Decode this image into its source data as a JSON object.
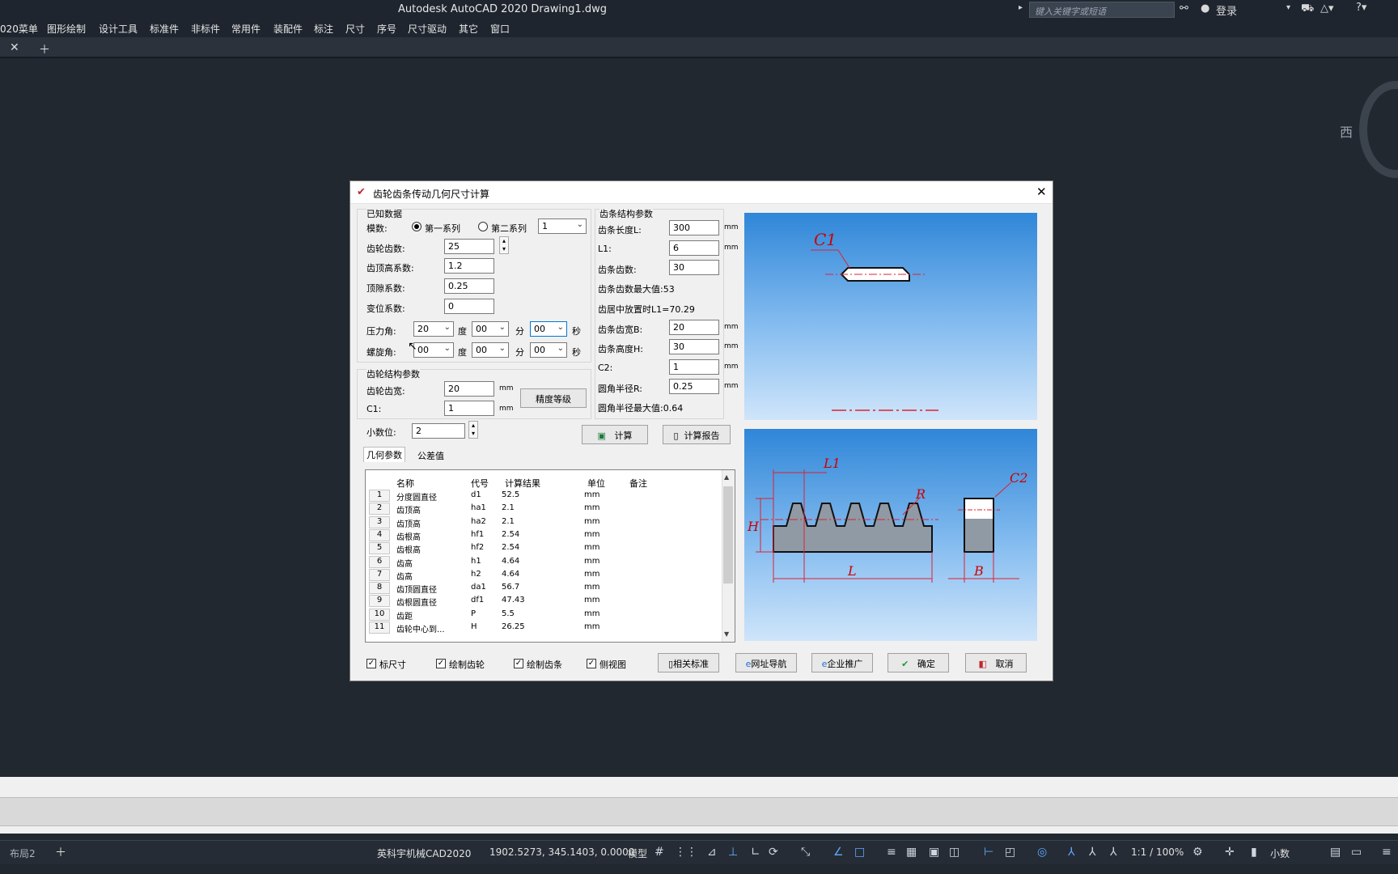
{
  "app": {
    "title": "Autodesk AutoCAD 2020    Drawing1.dwg",
    "search_placeholder": "键入关键字或短语",
    "login": "登录"
  },
  "menu": [
    "020菜单",
    "图形绘制",
    "设计工具",
    "标准件",
    "非标件",
    "常用件",
    "装配件",
    "标注",
    "尺寸",
    "序号",
    "尺寸驱动",
    "其它",
    "窗口"
  ],
  "viewcube": {
    "label": "西"
  },
  "status": {
    "layout_tab": "布局2",
    "software": "英科宇机械CAD2020",
    "coords": "1902.5273, 345.1403, 0.0000",
    "model": "模型",
    "scale": "1:1 / 100%",
    "units": "小数"
  },
  "dialog": {
    "title": "齿轮齿条传动几何尺寸计算",
    "known_group": "已知数据",
    "module_label": "模数:",
    "series1": "第一系列",
    "series2": "第二系列",
    "module_value": "1",
    "teeth_label": "齿轮齿数:",
    "teeth_value": "25",
    "addendum_label": "齿顶高系数:",
    "addendum_value": "1.2",
    "clearance_label": "顶隙系数:",
    "clearance_value": "0.25",
    "shift_label": "变位系数:",
    "shift_value": "0",
    "pressure_label": "压力角:",
    "pressure_deg": "20",
    "pressure_min": "00",
    "pressure_sec": "00",
    "helix_label": "螺旋角:",
    "helix_deg": "00",
    "helix_min": "00",
    "helix_sec": "00",
    "deg": "度",
    "min": "分",
    "sec": "秒",
    "gear_struct_group": "齿轮结构参数",
    "gear_width_label": "齿轮齿宽:",
    "gear_width_value": "20",
    "c1_label": "C1:",
    "c1_value": "1",
    "precision_button": "精度等级",
    "decimals_label": "小数位:",
    "decimals_value": "2",
    "calc_button": "计算",
    "report_button": "计算报告",
    "rack_group": "齿条结构参数",
    "rack_len_label": "齿条长度L:",
    "rack_len_value": "300",
    "l1_label": "L1:",
    "l1_value": "6",
    "rack_teeth_label": "齿条齿数:",
    "rack_teeth_value": "30",
    "rack_teeth_max": "齿条齿数最大值:53",
    "center_note": "齿居中放置时L1=70.29",
    "rack_width_label": "齿条齿宽B:",
    "rack_width_value": "20",
    "rack_height_label": "齿条高度H:",
    "rack_height_value": "30",
    "c2_label": "C2:",
    "c2_value": "1",
    "fillet_label": "圆角半径R:",
    "fillet_value": "0.25",
    "fillet_max": "圆角半径最大值:0.64",
    "unit": "mm",
    "tab_geo": "几何参数",
    "tab_tol": "公差值",
    "grid_headers": [
      "名称",
      "代号",
      "计算结果",
      "单位",
      "备注"
    ],
    "rows": [
      {
        "n": "1",
        "name": "分度圆直径",
        "code": "d1",
        "val": "52.5",
        "unit": "mm"
      },
      {
        "n": "2",
        "name": "齿顶高",
        "code": "ha1",
        "val": "2.1",
        "unit": "mm"
      },
      {
        "n": "3",
        "name": "齿顶高",
        "code": "ha2",
        "val": "2.1",
        "unit": "mm"
      },
      {
        "n": "4",
        "name": "齿根高",
        "code": "hf1",
        "val": "2.54",
        "unit": "mm"
      },
      {
        "n": "5",
        "name": "齿根高",
        "code": "hf2",
        "val": "2.54",
        "unit": "mm"
      },
      {
        "n": "6",
        "name": "齿高",
        "code": "h1",
        "val": "4.64",
        "unit": "mm"
      },
      {
        "n": "7",
        "name": "齿高",
        "code": "h2",
        "val": "4.64",
        "unit": "mm"
      },
      {
        "n": "8",
        "name": "齿顶圆直径",
        "code": "da1",
        "val": "56.7",
        "unit": "mm"
      },
      {
        "n": "9",
        "name": "齿根圆直径",
        "code": "df1",
        "val": "47.43",
        "unit": "mm"
      },
      {
        "n": "10",
        "name": "齿距",
        "code": "P",
        "val": "5.5",
        "unit": "mm"
      },
      {
        "n": "11",
        "name": "齿轮中心到...",
        "code": "H",
        "val": "26.25",
        "unit": "mm"
      }
    ],
    "chk_dim": "标尺寸",
    "chk_gear": "绘制齿轮",
    "chk_rack": "绘制齿条",
    "chk_side": "侧视图",
    "btn_std": "相关标准",
    "btn_web": "网址导航",
    "btn_ent": "企业推广",
    "btn_ok": "确定",
    "btn_cancel": "取消",
    "fig_labels": {
      "c1": "C1",
      "l1": "L1",
      "c2": "C2",
      "r": "R",
      "h": "H",
      "l": "L",
      "b": "B"
    }
  }
}
